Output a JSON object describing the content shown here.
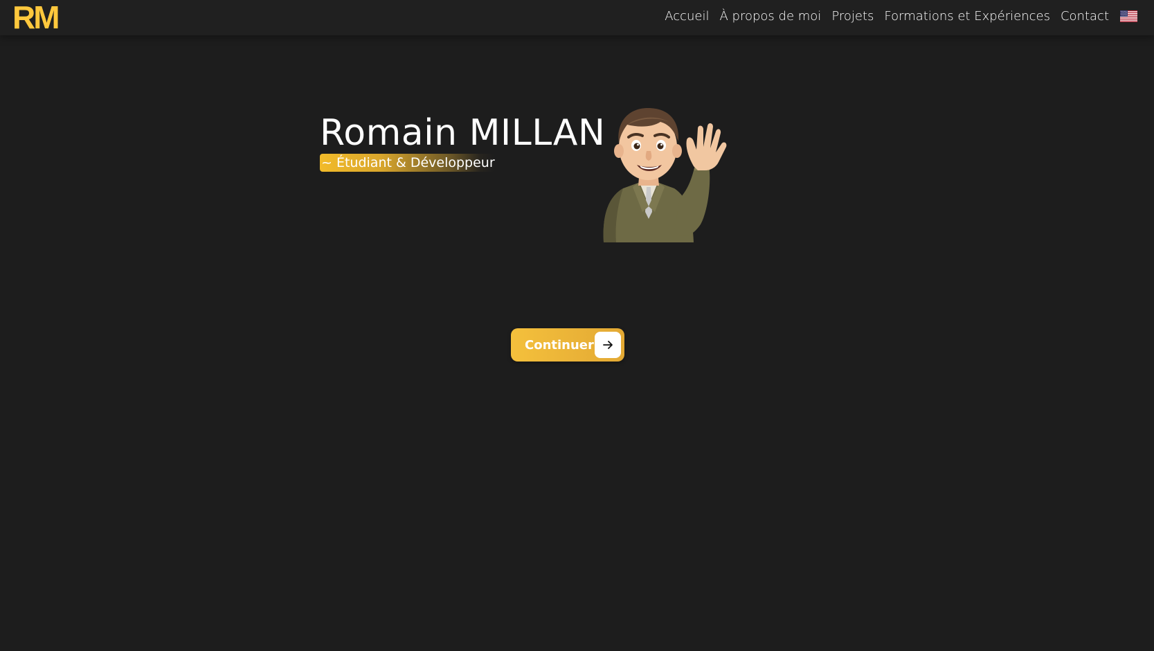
{
  "header": {
    "logo": "RM",
    "nav": [
      {
        "label": "Accueil"
      },
      {
        "label": "À propos de moi"
      },
      {
        "label": "Projets"
      },
      {
        "label": "Formations et Expériences"
      },
      {
        "label": "Contact"
      }
    ],
    "language_icon": "us-flag-icon"
  },
  "hero": {
    "name": "Romain MILLAN",
    "subtitle": "~ Étudiant & Développeur",
    "avatar_icon": "memoji-waving-avatar",
    "continue_label": "Continuer",
    "continue_icon": "arrow-right-icon"
  },
  "colors": {
    "background": "#1d1d1d",
    "header_background": "#202020",
    "accent": "#ffc83d",
    "text": "#ffffff"
  }
}
